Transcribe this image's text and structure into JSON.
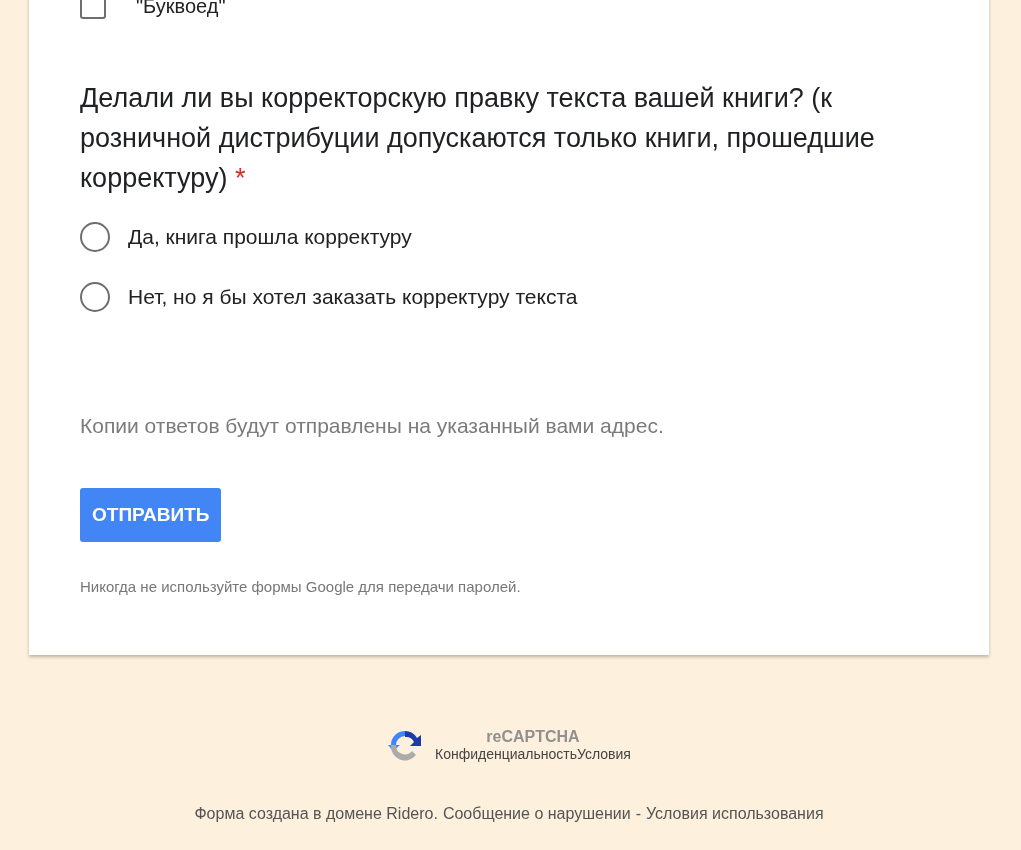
{
  "options_previous": [
    {
      "label": "\"Буквоед\"",
      "checked": false
    }
  ],
  "question": {
    "title": "Делали ли вы корректорскую правку текста вашей книги? (к розничной дистрибуции допускаются только книги, прошедшие корректуру)",
    "required_mark": "*",
    "options": [
      {
        "label": "Да, книга прошла корректуру",
        "selected": false
      },
      {
        "label": "Нет, но я бы хотел заказать корректуру текста",
        "selected": false
      }
    ]
  },
  "copy_note": "Копии ответов будут отправлены на указанный вами адрес.",
  "submit_button": "ОТПРАВИТЬ",
  "password_warning": "Никогда не используйте формы Google для передачи паролей.",
  "recaptcha": {
    "title": "reCAPTCHA",
    "links": [
      "Конфиденциальность",
      "Условия"
    ]
  },
  "footer": {
    "text": "Форма создана в домене Ridero.",
    "links": [
      {
        "label": "Сообщение о нарушении"
      },
      {
        "label": "Условия использования"
      }
    ],
    "separator": "-"
  }
}
